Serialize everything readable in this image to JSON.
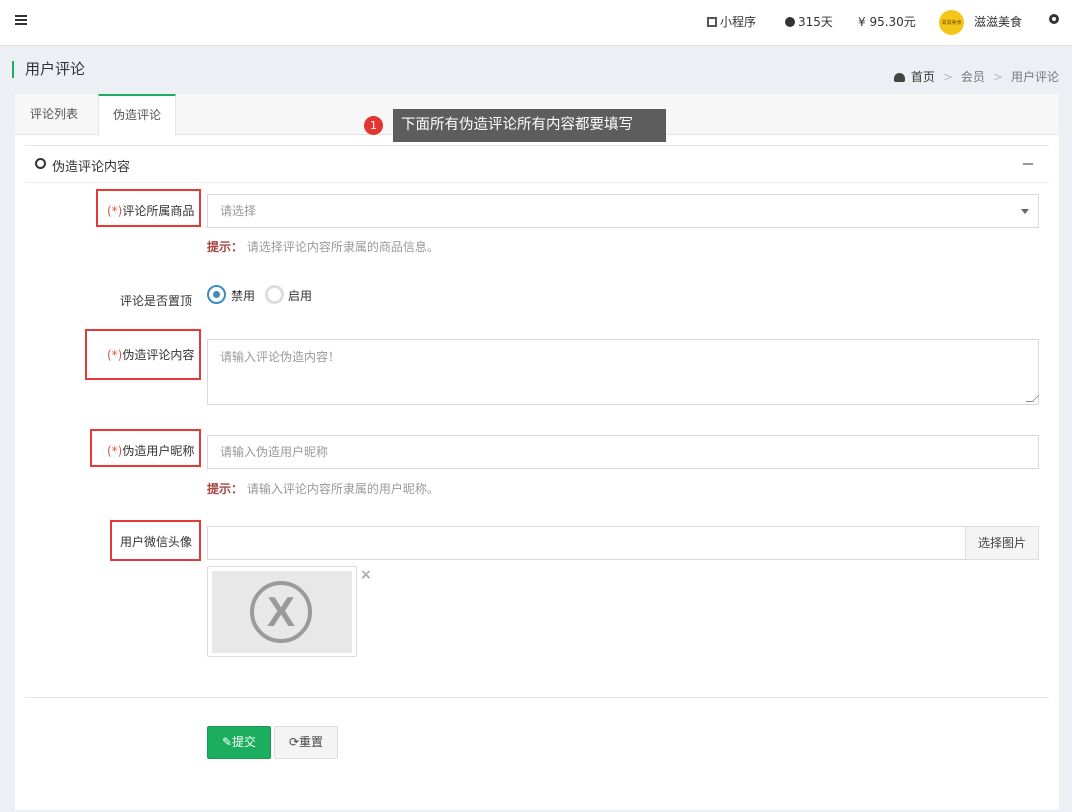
{
  "topbar": {
    "mini_program": "小程序",
    "days": "315天",
    "balance": "¥ 95.30元",
    "avatar_text": "滋滋美食",
    "store_name": "滋滋美食"
  },
  "page": {
    "title": "用户评论",
    "breadcrumb": [
      "首页",
      "会员",
      "用户评论"
    ]
  },
  "tabs": [
    "评论列表",
    "伪造评论"
  ],
  "annotation": {
    "badge": "1",
    "text": "下面所有伪造评论所有内容都要填写"
  },
  "section": {
    "title": "伪造评论内容"
  },
  "form": {
    "required_mark": "(*)",
    "product_label": "评论所属商品",
    "product_placeholder": "请选择",
    "product_hint_prefix": "提示：",
    "product_hint": "请选择评论内容所隶属的商品信息。",
    "pin_label": "评论是否置顶",
    "pin_options": [
      "禁用",
      "启用"
    ],
    "pin_selected": "禁用",
    "content_label": "伪造评论内容",
    "content_placeholder": "请输入评论伪造内容！",
    "nickname_label": "伪造用户昵称",
    "nickname_placeholder": "请输入伪造用户昵称",
    "nickname_hint_prefix": "提示：",
    "nickname_hint": "请输入评论内容所隶属的用户昵称。",
    "avatar_label": "用户微信头像",
    "avatar_value": "",
    "pick_image": "选择图片",
    "remove": "×"
  },
  "buttons": {
    "submit": "提交",
    "reset": "重置"
  },
  "colors": {
    "accent": "#1aae5e",
    "highlight_box": "#e53935",
    "radio": "#3c8dbc"
  }
}
